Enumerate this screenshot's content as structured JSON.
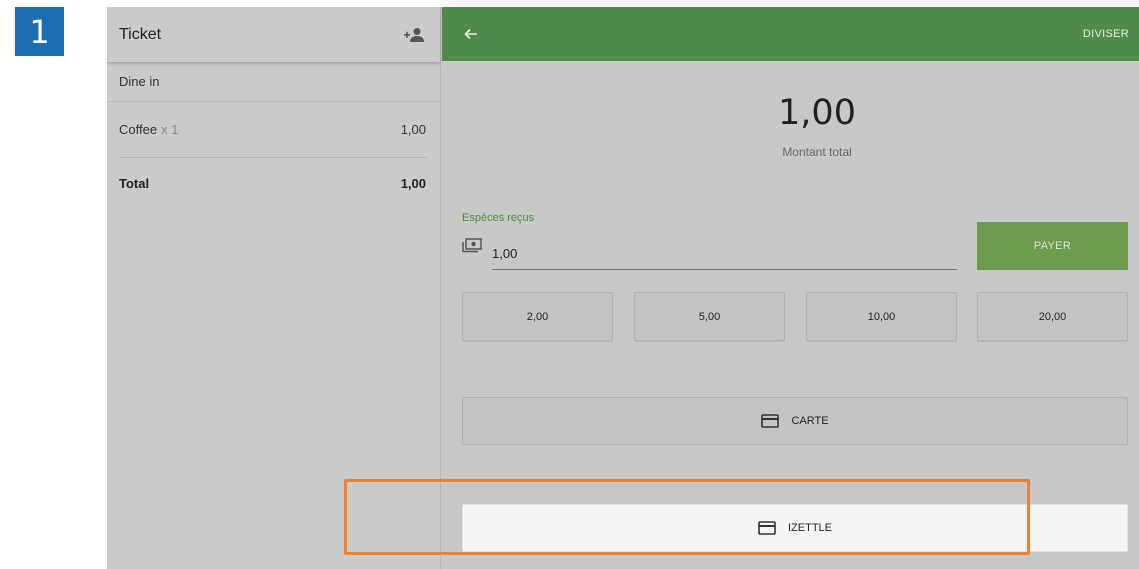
{
  "step": "1",
  "ticket": {
    "title": "Ticket",
    "dining_option": "Dine in",
    "items": [
      {
        "name": "Coffee",
        "qty": "x 1",
        "price": "1,00"
      }
    ],
    "total_label": "Total",
    "total_value": "1,00"
  },
  "payment": {
    "split_label": "DIVISER",
    "amount": "1,00",
    "amount_label": "Montant total",
    "cash_label": "Espèces reçus",
    "cash_value": "1,00",
    "pay_label": "PAYER",
    "quick_amounts": [
      "2,00",
      "5,00",
      "10,00",
      "20,00"
    ],
    "card_label": "CARTE",
    "izettle_label": "IZETTLE"
  },
  "colors": {
    "header_green": "#518b49",
    "pay_button": "#6e9a4d",
    "step_badge": "#1b6fb0",
    "highlight": "#ea8234"
  },
  "icons": [
    "add-customer-icon",
    "back-arrow-icon",
    "cash-icon",
    "card-icon"
  ]
}
